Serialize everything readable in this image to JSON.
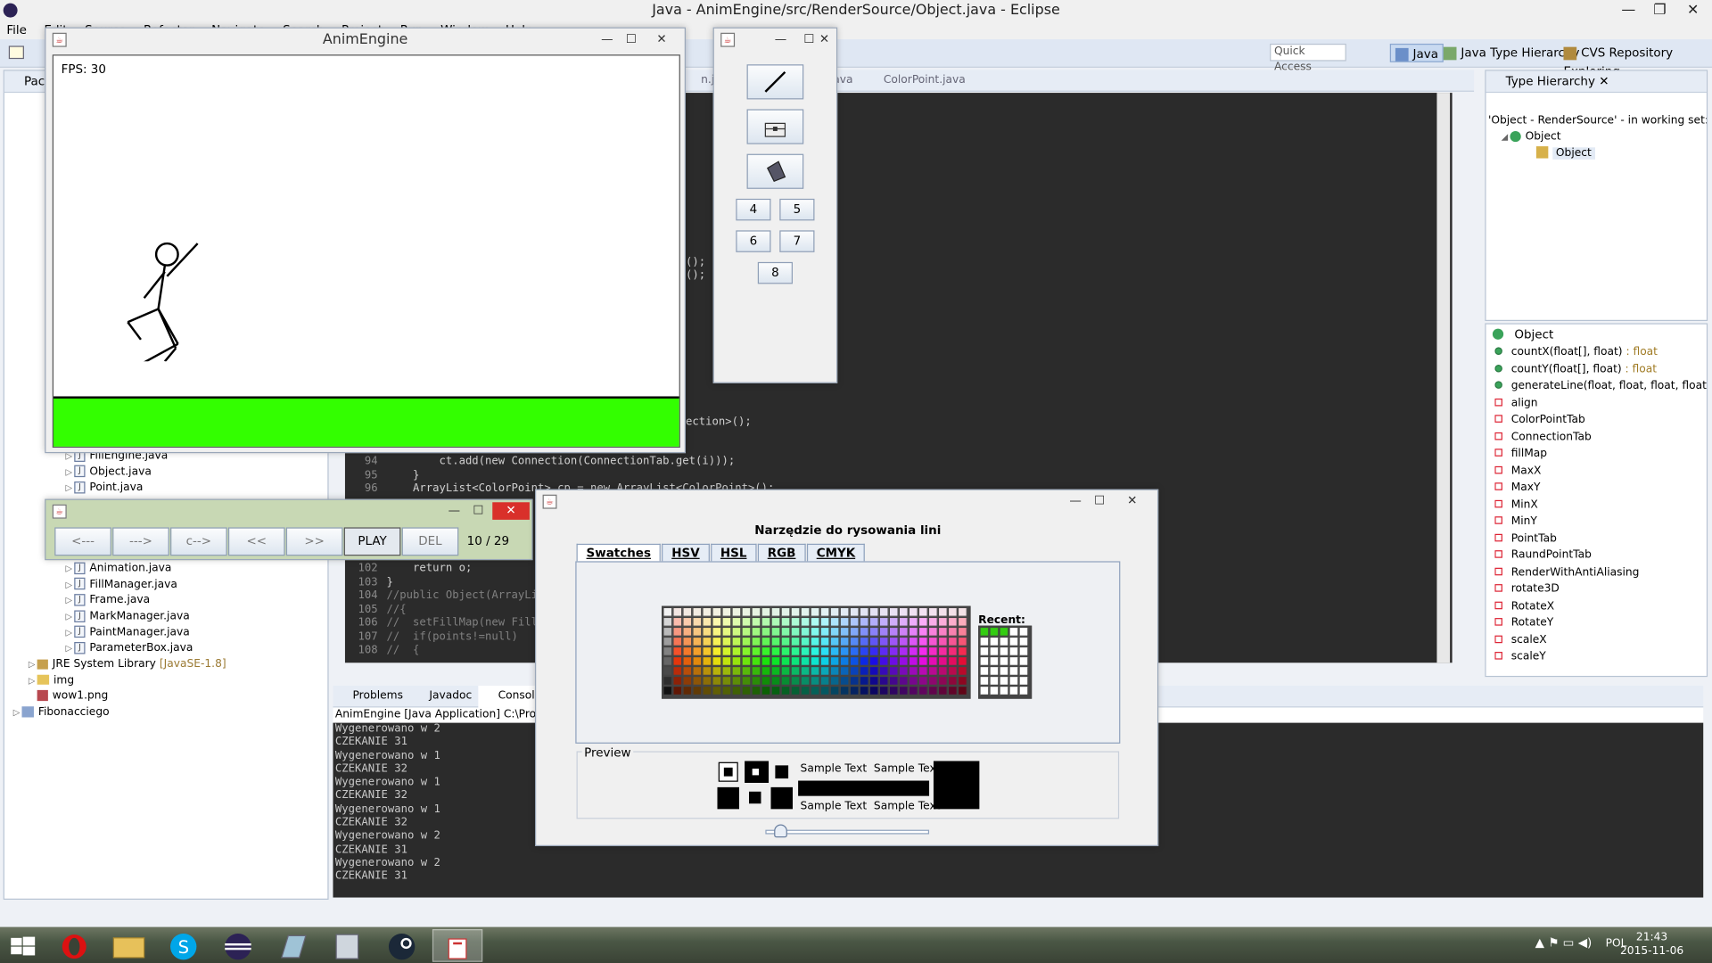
{
  "eclipse": {
    "title": "Java - AnimEngine/src/RenderSource/Object.java - Eclipse",
    "menu": [
      "File",
      "Edit",
      "Source",
      "Refactor",
      "Navigate",
      "Search",
      "Project",
      "Run",
      "Window",
      "Help"
    ],
    "quick_access": "Quick Access",
    "perspectives": [
      "Java",
      "Java Type Hierarchy",
      "CVS Repository Exploring"
    ],
    "editor_tabs": [
      "n.java",
      "Connection.java",
      "ColorPoint.java"
    ],
    "package_tab": "Pack",
    "tree_items_top": [
      "FillEngine.java",
      "Object.java",
      "Point.java"
    ],
    "tree_items_bottom": [
      "Animation.java",
      "FillManager.java",
      "Frame.java",
      "MarkManager.java",
      "PaintManager.java",
      "ParameterBox.java"
    ],
    "jre": "JRE System Library",
    "jre_version": "[JavaSE-1.8]",
    "img": "img",
    "wow": "wow1.png",
    "fib": "Fibonacciego",
    "code_lines": [
      {
        "n": "94",
        "t": "        ct.add(new Connection(ConnectionTab.get(i)));"
      },
      {
        "n": "95",
        "t": "    }"
      },
      {
        "n": "96",
        "t": "    ArrayList<ColorPoint> cp = new ArrayList<ColorPoint>();"
      },
      {
        "n": "102",
        "t": "    return o;"
      },
      {
        "n": "103",
        "t": "}"
      },
      {
        "n": "104",
        "t": "//public Object(ArrayList"
      },
      {
        "n": "105",
        "t": "//{"
      },
      {
        "n": "106",
        "t": "//  setFillMap(new FillMa"
      },
      {
        "n": "107",
        "t": "//  if(points!=null)"
      },
      {
        "n": "108",
        "t": "//  {"
      }
    ],
    "code_frag1": "();",
    "code_frag2": "();",
    "code_frag3": "ection>();",
    "hierarchy": {
      "tab": "Type Hierarchy",
      "info": "'Object - RenderSource' - in working set: Window",
      "root": "Object",
      "child": "Object"
    },
    "members_title": "Object",
    "members": [
      {
        "label": "countX(float[], float)",
        "type": " : float",
        "kind": "method"
      },
      {
        "label": "countY(float[], float)",
        "type": " : float",
        "kind": "method"
      },
      {
        "label": "generateLine(float, float, float, float)",
        "type": " : f",
        "kind": "method"
      },
      {
        "label": "align",
        "type": "",
        "kind": "field"
      },
      {
        "label": "ColorPointTab",
        "type": "",
        "kind": "field"
      },
      {
        "label": "ConnectionTab",
        "type": "",
        "kind": "field"
      },
      {
        "label": "fillMap",
        "type": "",
        "kind": "field"
      },
      {
        "label": "MaxX",
        "type": "",
        "kind": "field"
      },
      {
        "label": "MaxY",
        "type": "",
        "kind": "field"
      },
      {
        "label": "MinX",
        "type": "",
        "kind": "field"
      },
      {
        "label": "MinY",
        "type": "",
        "kind": "field"
      },
      {
        "label": "PointTab",
        "type": "",
        "kind": "field"
      },
      {
        "label": "RaundPointTab",
        "type": "",
        "kind": "field"
      },
      {
        "label": "RenderWithAntiAliasing",
        "type": "",
        "kind": "field"
      },
      {
        "label": "rotate3D",
        "type": "",
        "kind": "field"
      },
      {
        "label": "RotateX",
        "type": "",
        "kind": "field"
      },
      {
        "label": "RotateY",
        "type": "",
        "kind": "field"
      },
      {
        "label": "scaleX",
        "type": "",
        "kind": "field"
      },
      {
        "label": "scaleY",
        "type": "",
        "kind": "field"
      }
    ],
    "bottom_tabs": [
      "Problems",
      "Javadoc",
      "Console"
    ],
    "console_header": "AnimEngine [Java Application] C:\\Program",
    "console_lines": [
      "Wygenerowano w 2",
      "CZEKANIE 31",
      "Wygenerowano w 1",
      "CZEKANIE 32",
      "Wygenerowano w 1",
      "CZEKANIE 32",
      "Wygenerowano w 1",
      "CZEKANIE 32",
      "Wygenerowano w 2",
      "CZEKANIE 31",
      "Wygenerowano w 2",
      "CZEKANIE 31"
    ]
  },
  "anim": {
    "title": "AnimEngine",
    "fps": "FPS: 30",
    "ground_color": "#33ff00"
  },
  "tools": {
    "buttons": [
      "4",
      "5",
      "6",
      "7",
      "8"
    ]
  },
  "player": {
    "buttons": [
      "<---",
      "--->",
      "c-->",
      "<<",
      ">>",
      "PLAY",
      "DEL"
    ],
    "frame": "10 / 29"
  },
  "colorchooser": {
    "title": "Narzędzie do rysowania lini",
    "tabs": [
      "Swatches",
      "HSV",
      "HSL",
      "RGB",
      "CMYK"
    ],
    "recent": "Recent:",
    "preview": "Preview",
    "sample": "Sample Text"
  },
  "taskbar": {
    "lang": "POL",
    "time": "21:43",
    "date": "2015-11-06"
  }
}
